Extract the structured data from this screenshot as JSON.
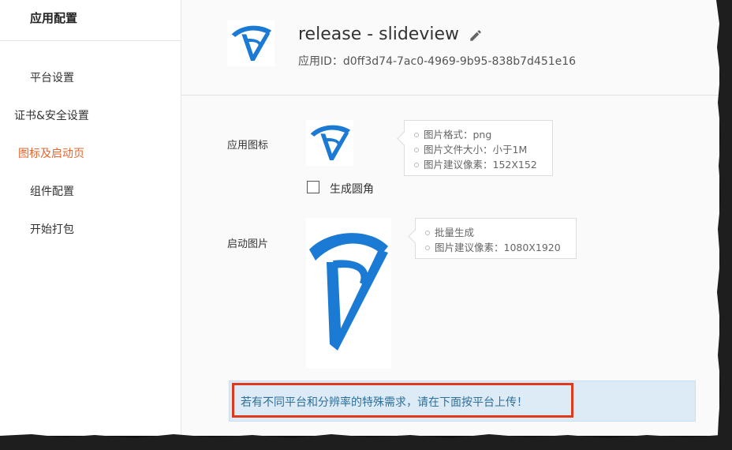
{
  "sidebar": {
    "header": "应用配置",
    "items": [
      {
        "label": "平台设置",
        "active": false
      },
      {
        "label": "证书&安全设置",
        "active": false
      },
      {
        "label": "图标及启动页",
        "active": true
      },
      {
        "label": "组件配置",
        "active": false
      },
      {
        "label": "开始打包",
        "active": false
      }
    ]
  },
  "app": {
    "title": "release - slideview",
    "id_label": "应用ID：",
    "id_value": "d0ff3d74-7ac0-4969-9b95-838b7d451e16"
  },
  "icon_section": {
    "label": "应用图标",
    "tips": [
      "图片格式：png",
      "图片文件大小：小于1M",
      "图片建议像素：152X152"
    ],
    "checkbox_label": "生成圆角",
    "checkbox_checked": false
  },
  "splash_section": {
    "label": "启动图片",
    "tips": [
      "批量生成",
      "图片建议像素：1080X1920"
    ]
  },
  "notice": {
    "text": "若有不同平台和分辨率的特殊需求，请在下面按平台上传！"
  },
  "colors": {
    "accent": "#e8642e",
    "logo_blue": "#1a7ad4",
    "highlight_red": "#e03a1e",
    "notice_bg": "#dcebf6"
  }
}
